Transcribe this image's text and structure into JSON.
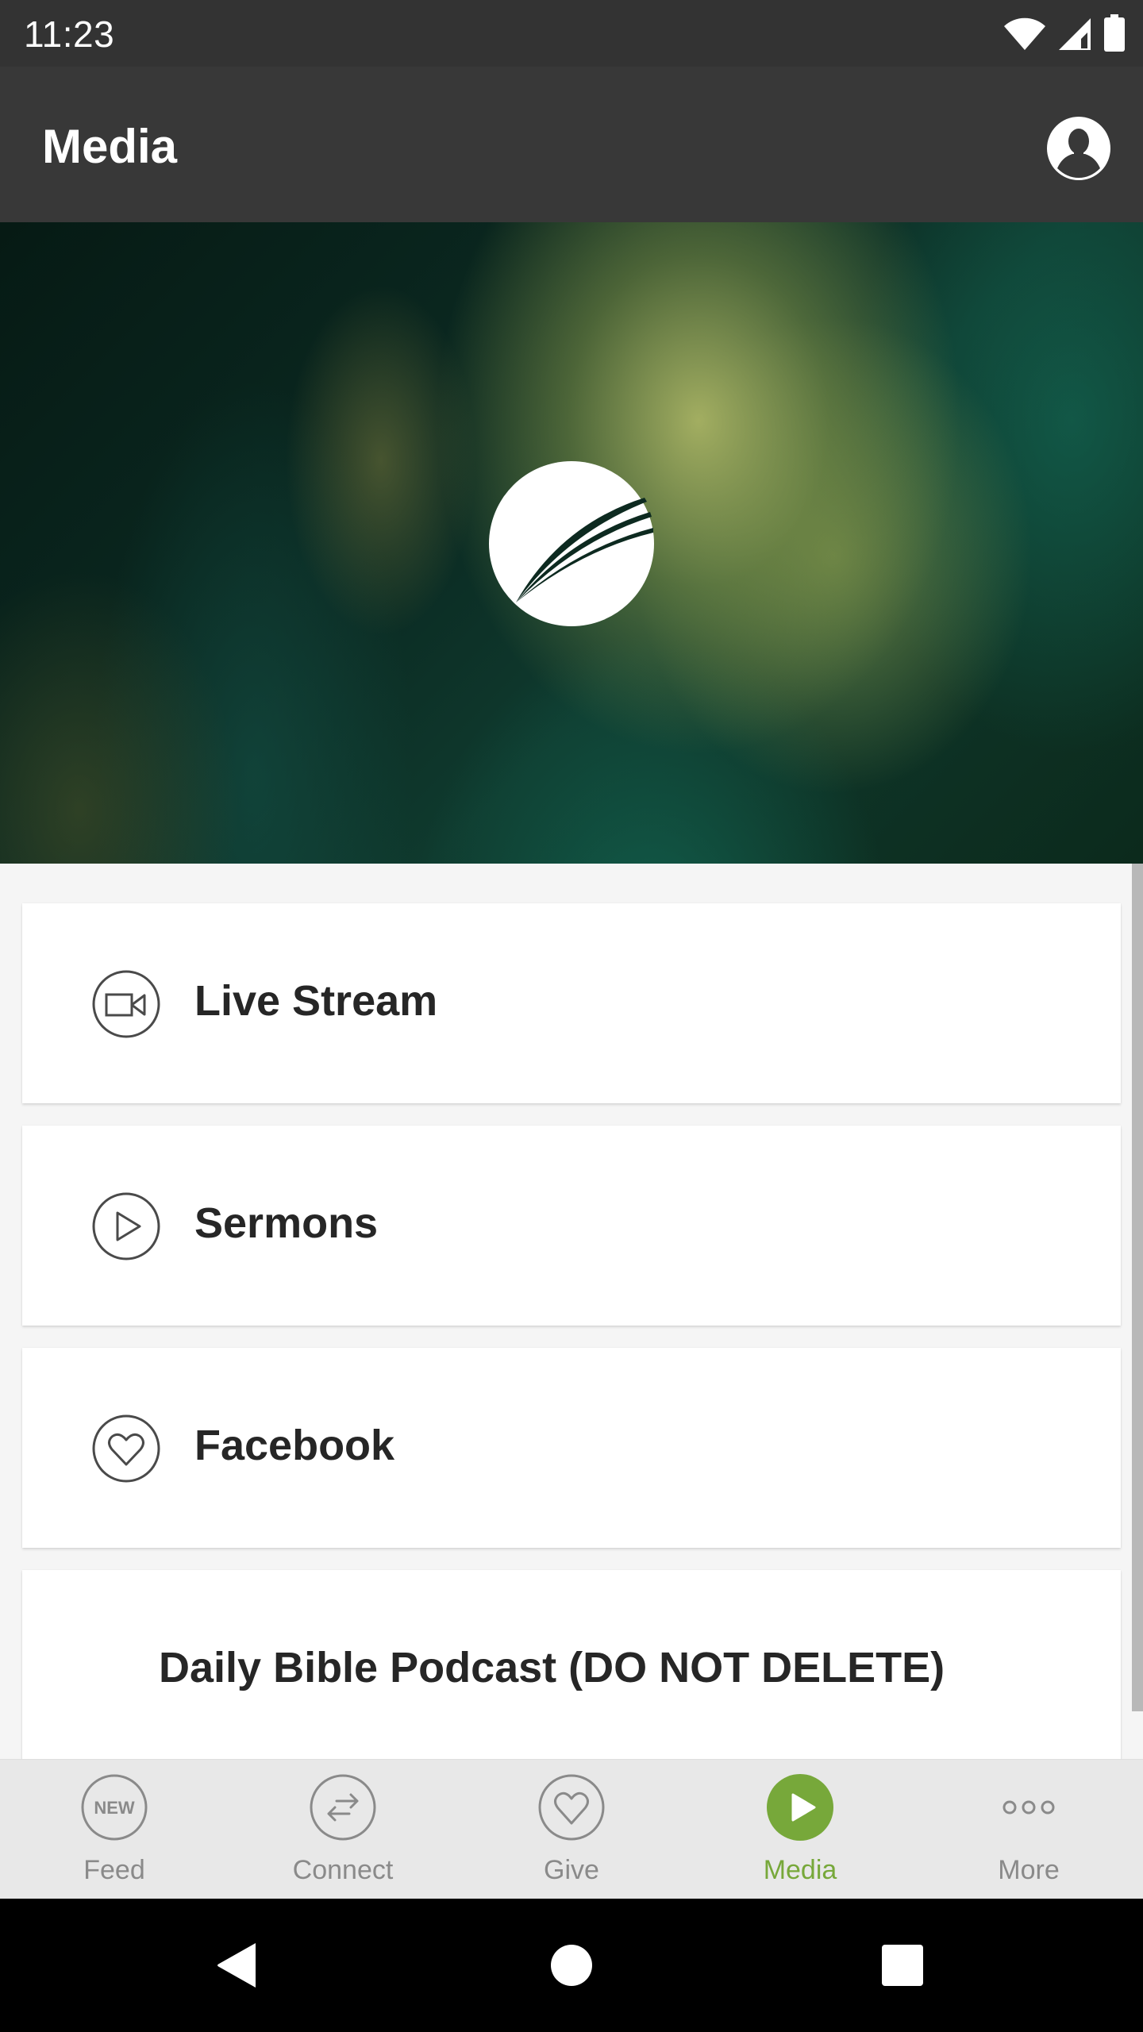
{
  "status_bar": {
    "time": "11:23",
    "icons": [
      "wifi-icon",
      "cell-signal-icon",
      "battery-icon"
    ]
  },
  "app_bar": {
    "title": "Media",
    "profile_icon": "account-circle-icon"
  },
  "hero": {
    "logo_icon": "church-logo-icon"
  },
  "media_list": {
    "items": [
      {
        "label": "Live Stream",
        "icon": "video-camera-icon"
      },
      {
        "label": "Sermons",
        "icon": "play-circle-icon"
      },
      {
        "label": "Facebook",
        "icon": "heart-circle-icon"
      },
      {
        "label": "Daily Bible Podcast (DO NOT DELETE)",
        "icon": null
      }
    ]
  },
  "bottom_nav": {
    "active_color": "#77a83a",
    "inactive_color": "#8a8a8a",
    "items": [
      {
        "label": "Feed",
        "icon": "new-badge-icon",
        "active": false,
        "badge_text": "NEW"
      },
      {
        "label": "Connect",
        "icon": "swap-arrows-icon",
        "active": false
      },
      {
        "label": "Give",
        "icon": "heart-icon",
        "active": false
      },
      {
        "label": "Media",
        "icon": "play-icon",
        "active": true
      },
      {
        "label": "More",
        "icon": "more-dots-icon",
        "active": false
      }
    ]
  },
  "system_nav": {
    "buttons": [
      "back",
      "home",
      "recents"
    ]
  }
}
